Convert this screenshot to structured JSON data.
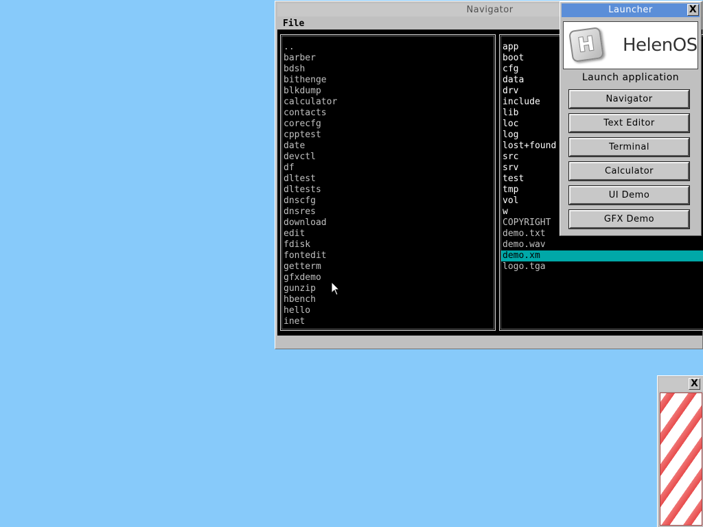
{
  "desktop": {
    "background": "#87CAFA"
  },
  "navigator": {
    "title": "Navigator",
    "menu": [
      "File"
    ],
    "left_panel": {
      "files": [
        {
          "name": "..",
          "dir": false
        },
        {
          "name": "barber",
          "dir": false
        },
        {
          "name": "bdsh",
          "dir": false
        },
        {
          "name": "bithenge",
          "dir": false
        },
        {
          "name": "blkdump",
          "dir": false
        },
        {
          "name": "calculator",
          "dir": false
        },
        {
          "name": "contacts",
          "dir": false
        },
        {
          "name": "corecfg",
          "dir": false
        },
        {
          "name": "cpptest",
          "dir": false
        },
        {
          "name": "date",
          "dir": false
        },
        {
          "name": "devctl",
          "dir": false
        },
        {
          "name": "df",
          "dir": false
        },
        {
          "name": "dltest",
          "dir": false
        },
        {
          "name": "dltests",
          "dir": false
        },
        {
          "name": "dnscfg",
          "dir": false
        },
        {
          "name": "dnsres",
          "dir": false
        },
        {
          "name": "download",
          "dir": false
        },
        {
          "name": "edit",
          "dir": false
        },
        {
          "name": "fdisk",
          "dir": false
        },
        {
          "name": "fontedit",
          "dir": false
        },
        {
          "name": "getterm",
          "dir": false
        },
        {
          "name": "gfxdemo",
          "dir": false
        },
        {
          "name": "gunzip",
          "dir": false
        },
        {
          "name": "hbench",
          "dir": false
        },
        {
          "name": "hello",
          "dir": false
        },
        {
          "name": "inet",
          "dir": false
        }
      ]
    },
    "right_panel": {
      "selected_index": 19,
      "files": [
        {
          "name": "app",
          "dir": true
        },
        {
          "name": "boot",
          "dir": true
        },
        {
          "name": "cfg",
          "dir": true
        },
        {
          "name": "data",
          "dir": true
        },
        {
          "name": "drv",
          "dir": true
        },
        {
          "name": "include",
          "dir": true
        },
        {
          "name": "lib",
          "dir": true
        },
        {
          "name": "loc",
          "dir": true
        },
        {
          "name": "log",
          "dir": true
        },
        {
          "name": "lost+found",
          "dir": true
        },
        {
          "name": "src",
          "dir": true
        },
        {
          "name": "srv",
          "dir": true
        },
        {
          "name": "test",
          "dir": true
        },
        {
          "name": "tmp",
          "dir": true
        },
        {
          "name": "vol",
          "dir": true
        },
        {
          "name": "w",
          "dir": true
        },
        {
          "name": "COPYRIGHT",
          "dir": false
        },
        {
          "name": "demo.txt",
          "dir": false
        },
        {
          "name": "demo.wav",
          "dir": false
        },
        {
          "name": "demo.xm",
          "dir": false
        },
        {
          "name": "logo.tga",
          "dir": false
        }
      ]
    }
  },
  "launcher": {
    "title": "Launcher",
    "close_label": "X",
    "logo_letter": "H",
    "logo_text": "HelenOS",
    "caption": "Launch application",
    "buttons": [
      "Navigator",
      "Text Editor",
      "Terminal",
      "Calculator",
      "UI Demo",
      "GFX Demo"
    ]
  },
  "candy_window": {
    "close_label": "X"
  },
  "colors": {
    "selection": "#00A8A8",
    "launcher_title": "#5B8ED8",
    "candy_red": "#E84B4B"
  }
}
